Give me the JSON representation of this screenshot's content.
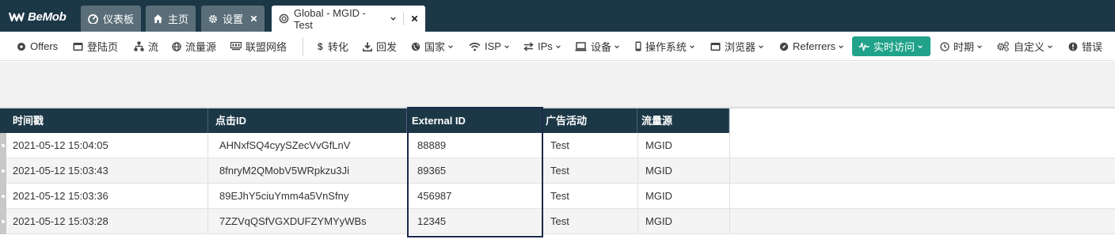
{
  "app": {
    "logo_text": "BeMob"
  },
  "tabs": [
    {
      "label": "仪表板",
      "icon": "dashboard-icon"
    },
    {
      "label": "主页",
      "icon": "home-icon"
    },
    {
      "label": "设置",
      "icon": "gear-icon"
    },
    {
      "label": "Global - MGID - Test",
      "icon": "campaign-icon",
      "active": true
    }
  ],
  "toolbar": {
    "items": [
      {
        "label": "Offers",
        "icon": "offer-icon",
        "dropdown": false
      },
      {
        "label": "登陆页",
        "icon": "landing-page-icon",
        "dropdown": false
      },
      {
        "label": "流",
        "icon": "flow-icon",
        "dropdown": false
      },
      {
        "label": "流量源",
        "icon": "globe-icon",
        "dropdown": false
      },
      {
        "label": "联盟网络",
        "icon": "network-icon",
        "dropdown": false
      },
      {
        "label": "转化",
        "icon": "dollar-icon",
        "dropdown": false
      },
      {
        "label": "回发",
        "icon": "download-icon",
        "dropdown": false
      },
      {
        "label": "国家",
        "icon": "globe-icon",
        "dropdown": true
      },
      {
        "label": "ISP",
        "icon": "wifi-icon",
        "dropdown": true
      },
      {
        "label": "IPs",
        "icon": "exchange-icon",
        "dropdown": true
      },
      {
        "label": "设备",
        "icon": "laptop-icon",
        "dropdown": true
      },
      {
        "label": "操作系统",
        "icon": "mobile-icon",
        "dropdown": true
      },
      {
        "label": "浏览器",
        "icon": "browser-icon",
        "dropdown": true
      },
      {
        "label": "Referrers",
        "icon": "compass-icon",
        "dropdown": true
      },
      {
        "label": "实时访问",
        "icon": "pulse-icon",
        "dropdown": true,
        "active": true
      },
      {
        "label": "时期",
        "icon": "clock-icon",
        "dropdown": true
      },
      {
        "label": "自定义",
        "icon": "cogs-icon",
        "dropdown": true
      },
      {
        "label": "错误",
        "icon": "error-icon",
        "dropdown": false
      }
    ]
  },
  "table": {
    "columns": [
      "时间戳",
      "点击ID",
      "External ID",
      "广告活动",
      "流量源"
    ],
    "rows": [
      [
        "2021-05-12 15:04:05",
        "AHNxfSQ4cyySZecVvGfLnV",
        "88889",
        "Test",
        "MGID"
      ],
      [
        "2021-05-12 15:03:43",
        "8fnryM2QMobV5WRpkzu3Ji",
        "89365",
        "Test",
        "MGID"
      ],
      [
        "2021-05-12 15:03:36",
        "89EJhY5ciuYmm4a5VnSfny",
        "456987",
        "Test",
        "MGID"
      ],
      [
        "2021-05-12 15:03:28",
        "7ZZVqQSfVGXDUFZYMYyWBs",
        "12345",
        "Test",
        "MGID"
      ]
    ]
  },
  "colors": {
    "header_bg": "#1c3847",
    "tab_inactive_bg": "#5a6e79",
    "live_button_bg": "#20a38a",
    "highlight_border": "#1c2a4a"
  }
}
